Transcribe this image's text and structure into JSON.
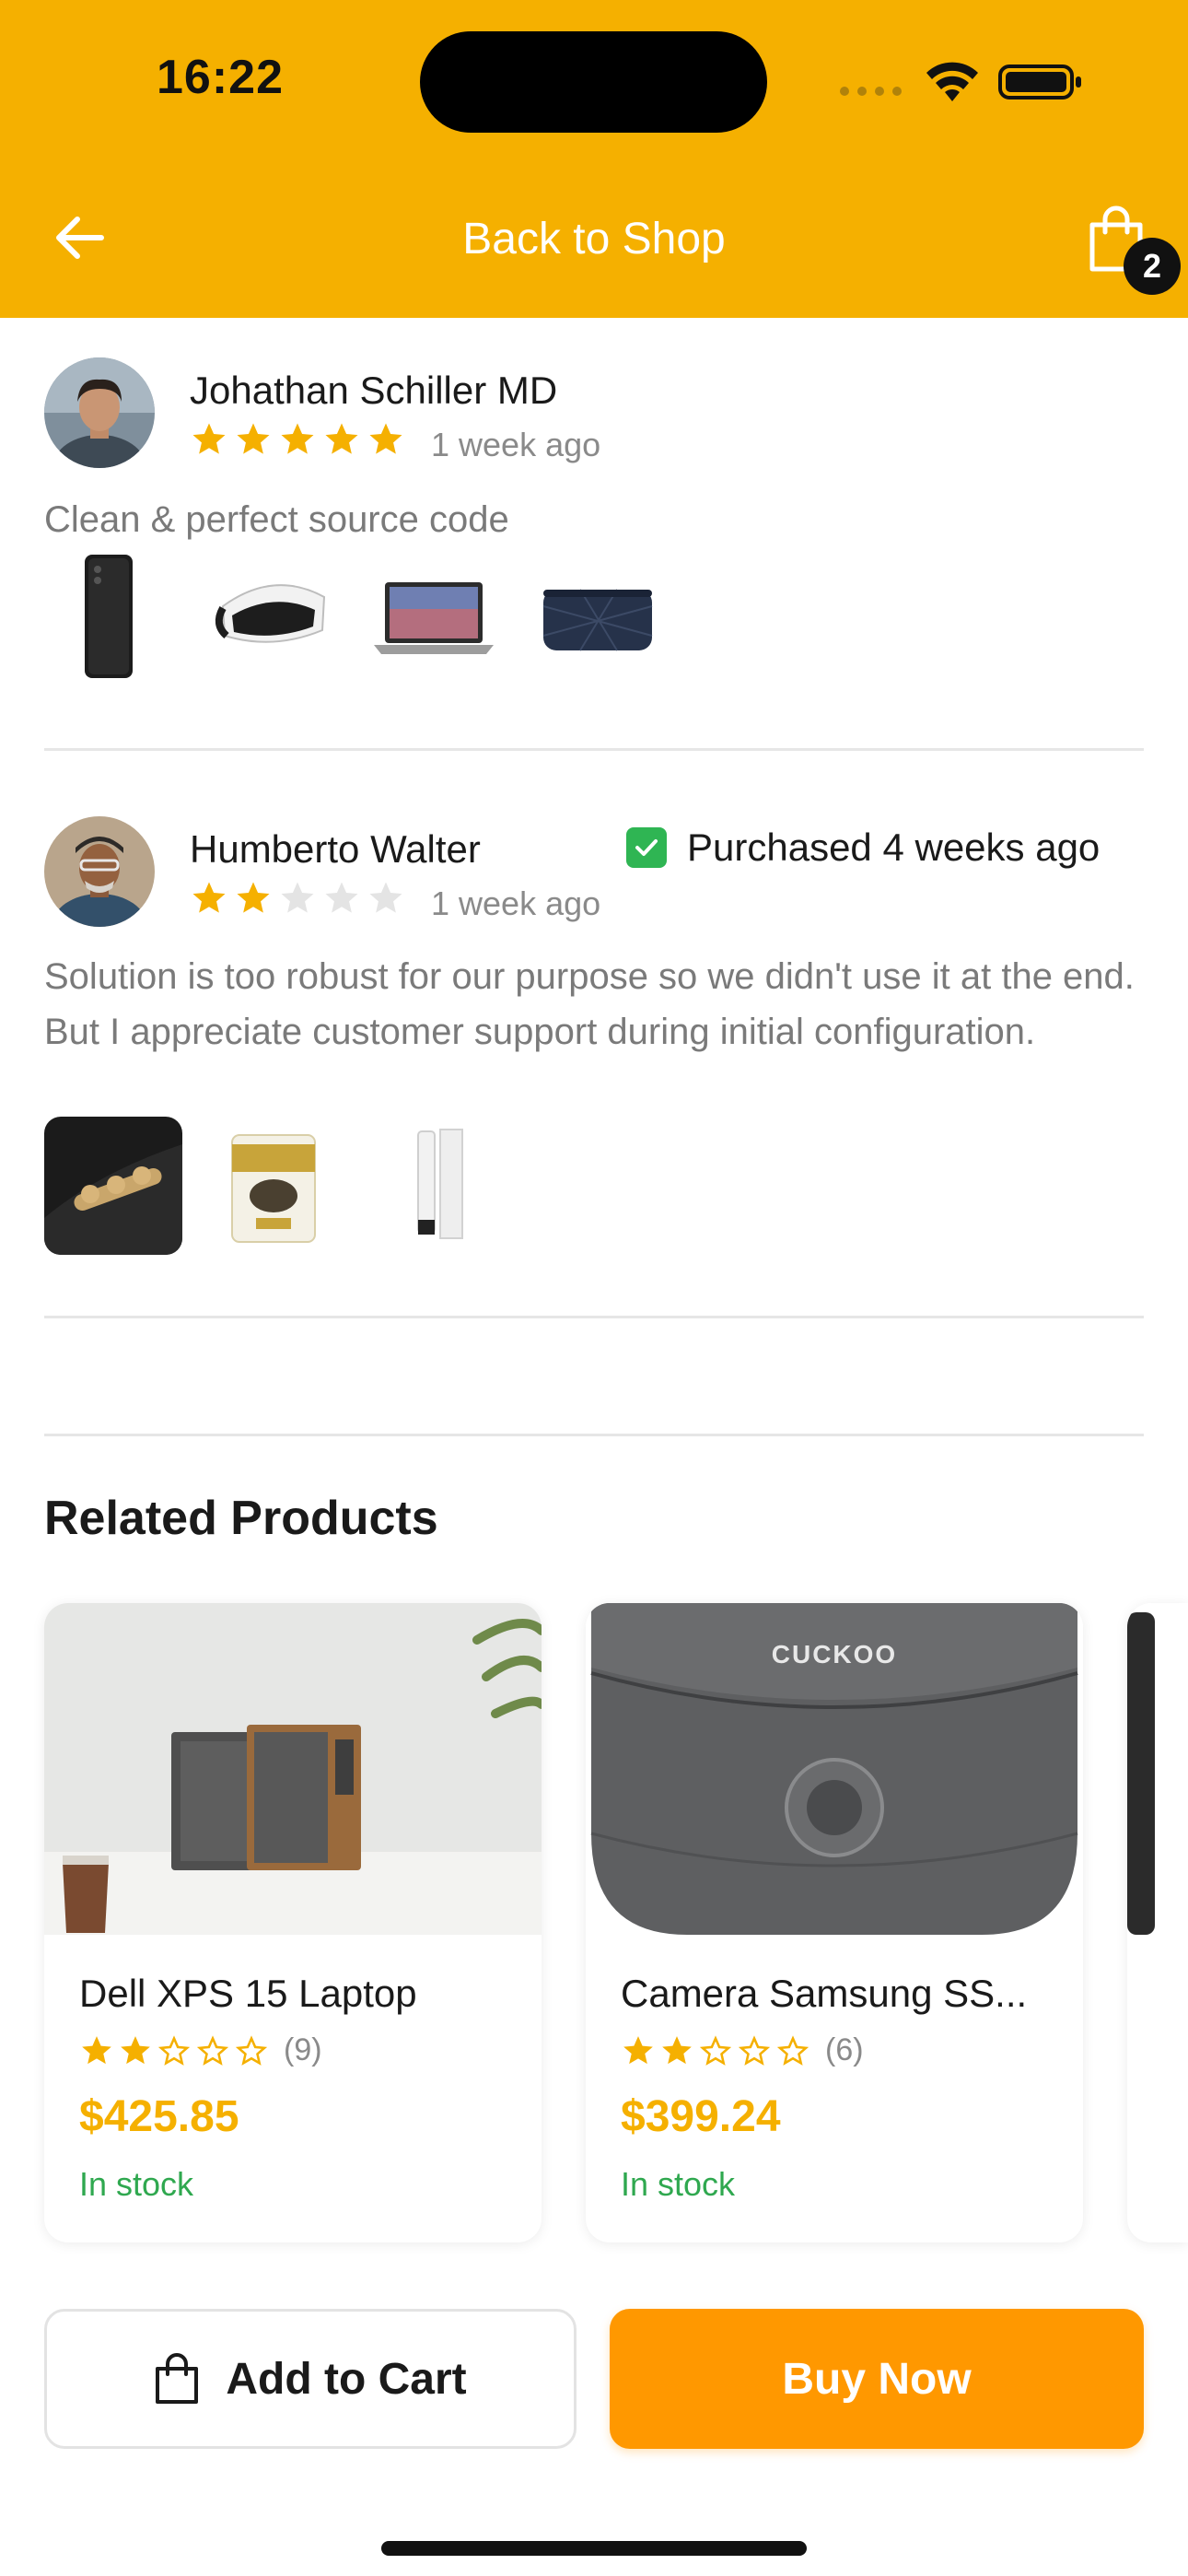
{
  "status_bar": {
    "time": "16:22"
  },
  "nav": {
    "title": "Back to Shop",
    "cart_count": "2"
  },
  "reviews": [
    {
      "name": "Johathan Schiller MD",
      "rating": 5,
      "time": "1 week ago",
      "text": "Clean & perfect source code",
      "images": [
        "phone",
        "vr-headset",
        "laptop",
        "pouch"
      ]
    },
    {
      "name": "Humberto Walter",
      "rating": 2,
      "time": "1 week ago",
      "purchased": "Purchased 4 weeks ago",
      "text": "Solution is too robust for our purpose so we didn't use it at the end. But I appreciate customer support during initial configuration.",
      "images": [
        "speaker",
        "food-can",
        "cosmetic-tube"
      ]
    }
  ],
  "related": {
    "title": "Related Products",
    "products": [
      {
        "name": "Dell XPS 15 Laptop",
        "rating": 2,
        "count": "(9)",
        "price": "$425.85",
        "stock": "In stock",
        "image": "speakers"
      },
      {
        "name": "Camera Samsung SS...",
        "rating": 2,
        "count": "(6)",
        "price": "$399.24",
        "stock": "In stock",
        "image": "rice-cooker",
        "brand": "CUCKOO"
      }
    ]
  },
  "actions": {
    "add_to_cart": "Add to Cart",
    "buy_now": "Buy Now"
  },
  "colors": {
    "header": "#F5B000",
    "star": "#F5B000",
    "price": "#F5B000",
    "buy": "#FF9800",
    "stock": "#2fa84f"
  }
}
